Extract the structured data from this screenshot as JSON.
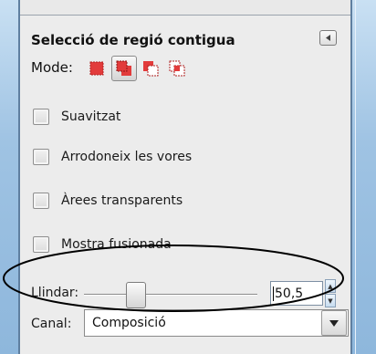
{
  "tool": {
    "title": "Selecció de regió contigua",
    "mode_label": "Mode:",
    "modes": [
      "replace-mode-icon",
      "add-mode-icon",
      "subtract-mode-icon",
      "intersect-mode-icon"
    ],
    "active_mode": 1
  },
  "options": [
    {
      "label": "Suavitzat",
      "checked": false
    },
    {
      "label": "Arrodoneix les vores",
      "checked": false
    },
    {
      "label": "Àrees transparents",
      "checked": false
    },
    {
      "label": "Mostra fusionada",
      "checked": false
    }
  ],
  "threshold": {
    "label": "Llindar:",
    "value": "50,5"
  },
  "channel": {
    "label": "Canal:",
    "value": "Composició"
  },
  "colors": {
    "accent": "#e53935",
    "highlight_ellipse": "#000000"
  }
}
